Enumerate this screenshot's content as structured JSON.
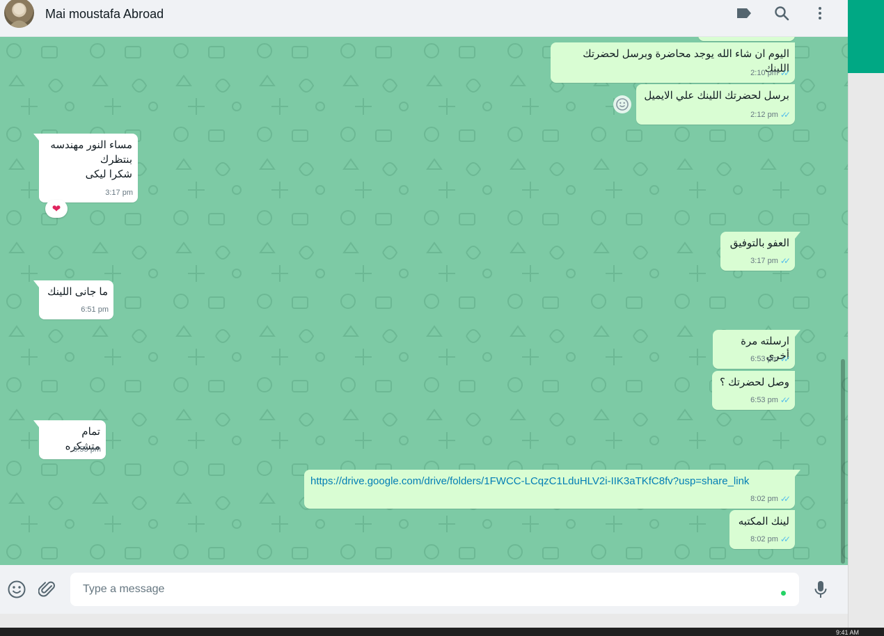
{
  "header": {
    "contact_name": "Mai moustafa Abroad",
    "icons": [
      "label-icon",
      "search-icon",
      "menu-icon"
    ]
  },
  "messages": [
    {
      "dir": "out",
      "text": "",
      "time": "",
      "partial": true
    },
    {
      "dir": "out",
      "text": "اليوم ان شاء الله يوجد محاضرة وبرسل لحضرتك اللينك",
      "time": "2:10 pm",
      "status": "read"
    },
    {
      "dir": "out",
      "text": "برسل لحضرتك اللينك علي الايميل",
      "time": "2:12 pm",
      "status": "read"
    },
    {
      "dir": "in",
      "lines": [
        "مساء النور مهندسه",
        "بنتظرك",
        "شكرا ليكى"
      ],
      "time": "3:17 pm",
      "reaction": "❤"
    },
    {
      "dir": "out",
      "text": "العفو بالتوفيق",
      "time": "3:17 pm",
      "status": "read"
    },
    {
      "dir": "in",
      "text": "ما جانى اللينك",
      "time": "6:51 pm"
    },
    {
      "dir": "out",
      "text": "ارسلته مرة أخري",
      "time": "6:53 pm",
      "status": "read"
    },
    {
      "dir": "out",
      "text": "وصل لحضرتك ؟",
      "time": "6:53 pm",
      "status": "read"
    },
    {
      "dir": "in",
      "text": "تمام متشكره",
      "time": "6:55 pm"
    },
    {
      "dir": "out",
      "text": "https://drive.google.com/drive/folders/1FWCC-LCqzC1LduHLV2i-IIK3aTKfC8fv?usp=share_link",
      "time": "8:02 pm",
      "status": "read",
      "is_link": true
    },
    {
      "dir": "out",
      "text": "لينك المكتبه",
      "time": "8:02 pm",
      "status": "read"
    }
  ],
  "composer": {
    "placeholder": "Type a message",
    "icons": [
      "emoji-icon",
      "attach-icon",
      "mic-icon"
    ]
  },
  "taskbar": {
    "time": "9:41 AM"
  },
  "colors": {
    "chat_bg": "#7dcaa5",
    "outgoing": "#d9fdd3",
    "incoming": "#ffffff",
    "accent": "#00a884",
    "read_ticks": "#53bdeb"
  }
}
